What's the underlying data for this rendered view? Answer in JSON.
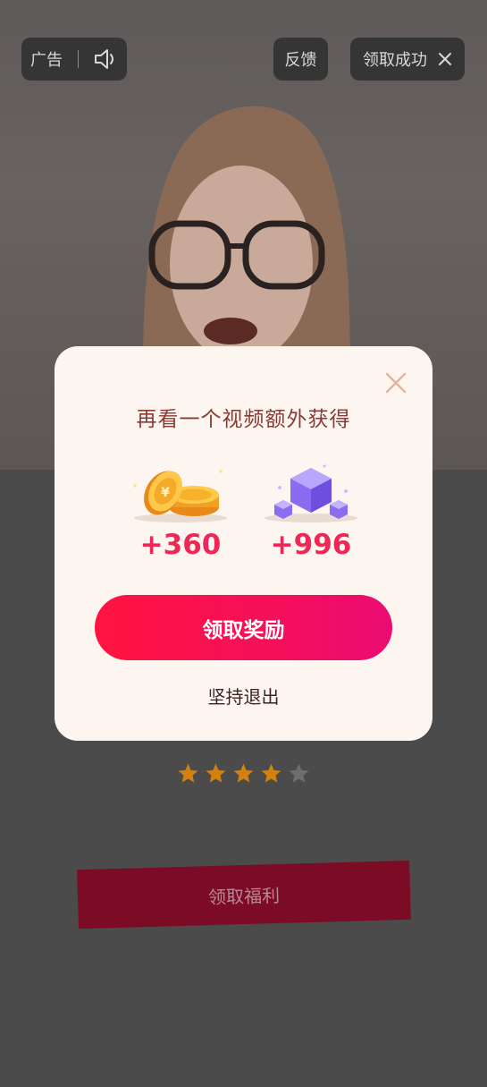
{
  "top_bar": {
    "ad_label": "广告",
    "feedback_label": "反馈",
    "success_label": "领取成功"
  },
  "rating": {
    "value": 4,
    "max": 5
  },
  "welfare_button_label": "领取福利",
  "modal": {
    "title": "再看一个视频额外获得",
    "rewards": [
      {
        "icon": "gold-coins-icon",
        "amount": "+360"
      },
      {
        "icon": "purple-gem-cube-icon",
        "amount": "+996"
      }
    ],
    "claim_label": "领取奖励",
    "quit_label": "坚持退出"
  },
  "colors": {
    "accent": "#ff1340",
    "amount": "#ee2757",
    "title": "#8a3a33",
    "modal_bg": "#fdf6f0",
    "star_on": "#d4800f",
    "star_off": "#8a8a8a"
  }
}
